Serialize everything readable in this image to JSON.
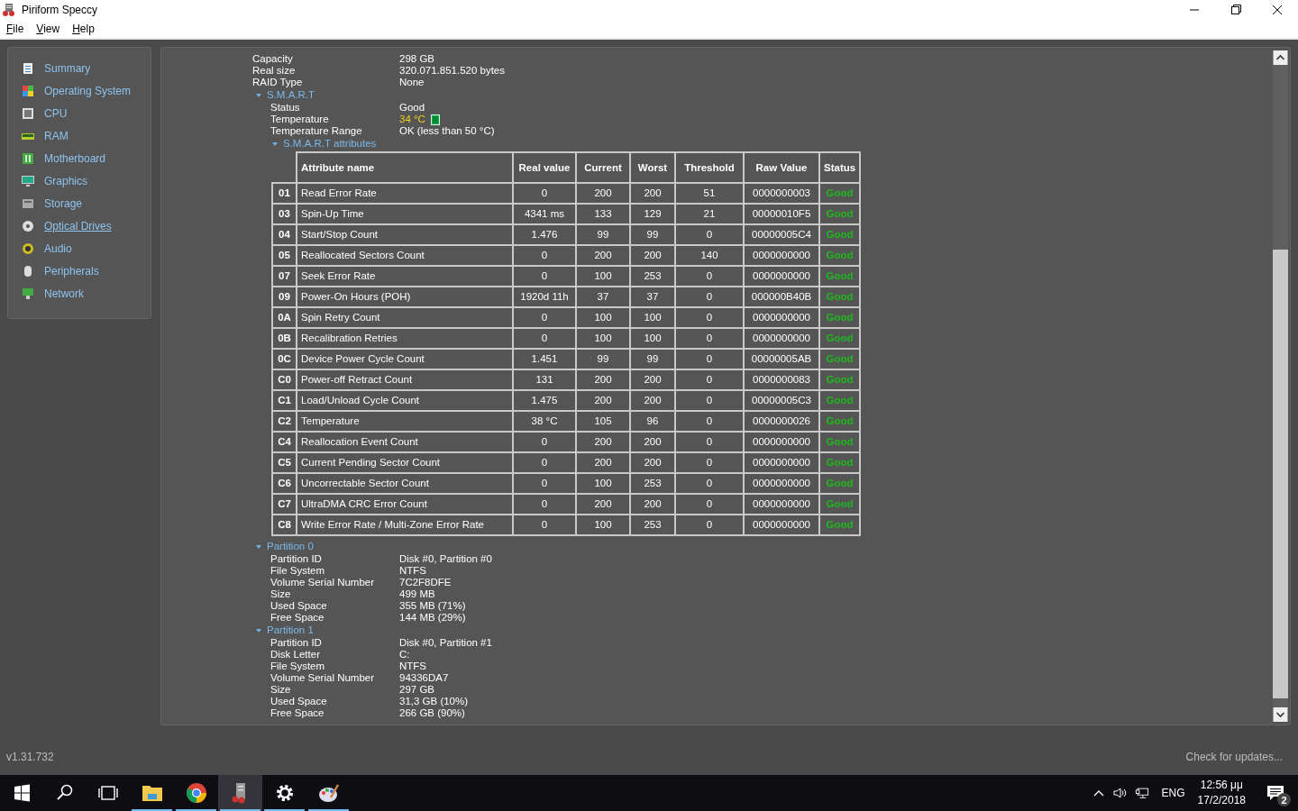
{
  "window": {
    "title": "Piriform Speccy"
  },
  "menu": [
    {
      "label": "File"
    },
    {
      "label": "View"
    },
    {
      "label": "Help"
    }
  ],
  "sidebar": {
    "items": [
      {
        "label": "Summary",
        "hovered": false
      },
      {
        "label": "Operating System",
        "hovered": false
      },
      {
        "label": "CPU",
        "hovered": false
      },
      {
        "label": "RAM",
        "hovered": false
      },
      {
        "label": "Motherboard",
        "hovered": false
      },
      {
        "label": "Graphics",
        "hovered": false
      },
      {
        "label": "Storage",
        "hovered": false
      },
      {
        "label": "Optical Drives",
        "hovered": true
      },
      {
        "label": "Audio",
        "hovered": false
      },
      {
        "label": "Peripherals",
        "hovered": false
      },
      {
        "label": "Network",
        "hovered": false
      }
    ]
  },
  "details": {
    "rows": [
      {
        "label": "Capacity",
        "value": "298 GB"
      },
      {
        "label": "Real size",
        "value": "320.071.851.520 bytes"
      },
      {
        "label": "RAID Type",
        "value": "None"
      }
    ],
    "smart": {
      "label": "S.M.A.R.T",
      "expanded": true,
      "rows": [
        {
          "kind": "text",
          "label": "Status",
          "value": "Good"
        },
        {
          "kind": "temperature",
          "label": "Temperature",
          "value": "34 °C"
        },
        {
          "kind": "text",
          "label": "Temperature Range",
          "value": "OK (less than 50 °C)"
        }
      ],
      "attributes": {
        "label": "S.M.A.R.T attributes",
        "expanded": true,
        "columns": [
          "Attribute name",
          "Real value",
          "Current",
          "Worst",
          "Threshold",
          "Raw Value",
          "Status"
        ],
        "rows": [
          {
            "id": "01",
            "name": "Read Error Rate",
            "real": "0",
            "current": "200",
            "worst": "200",
            "threshold": "51",
            "raw": "0000000003",
            "status": "Good"
          },
          {
            "id": "03",
            "name": "Spin-Up Time",
            "real": "4341 ms",
            "current": "133",
            "worst": "129",
            "threshold": "21",
            "raw": "00000010F5",
            "status": "Good"
          },
          {
            "id": "04",
            "name": "Start/Stop Count",
            "real": "1.476",
            "current": "99",
            "worst": "99",
            "threshold": "0",
            "raw": "00000005C4",
            "status": "Good"
          },
          {
            "id": "05",
            "name": "Reallocated Sectors Count",
            "real": "0",
            "current": "200",
            "worst": "200",
            "threshold": "140",
            "raw": "0000000000",
            "status": "Good"
          },
          {
            "id": "07",
            "name": "Seek Error Rate",
            "real": "0",
            "current": "100",
            "worst": "253",
            "threshold": "0",
            "raw": "0000000000",
            "status": "Good"
          },
          {
            "id": "09",
            "name": "Power-On Hours (POH)",
            "real": "1920d 11h",
            "current": "37",
            "worst": "37",
            "threshold": "0",
            "raw": "000000B40B",
            "status": "Good"
          },
          {
            "id": "0A",
            "name": "Spin Retry Count",
            "real": "0",
            "current": "100",
            "worst": "100",
            "threshold": "0",
            "raw": "0000000000",
            "status": "Good"
          },
          {
            "id": "0B",
            "name": "Recalibration Retries",
            "real": "0",
            "current": "100",
            "worst": "100",
            "threshold": "0",
            "raw": "0000000000",
            "status": "Good"
          },
          {
            "id": "0C",
            "name": "Device Power Cycle Count",
            "real": "1.451",
            "current": "99",
            "worst": "99",
            "threshold": "0",
            "raw": "00000005AB",
            "status": "Good"
          },
          {
            "id": "C0",
            "name": "Power-off Retract Count",
            "real": "131",
            "current": "200",
            "worst": "200",
            "threshold": "0",
            "raw": "0000000083",
            "status": "Good"
          },
          {
            "id": "C1",
            "name": "Load/Unload Cycle Count",
            "real": "1.475",
            "current": "200",
            "worst": "200",
            "threshold": "0",
            "raw": "00000005C3",
            "status": "Good"
          },
          {
            "id": "C2",
            "name": "Temperature",
            "real": "38 °C",
            "current": "105",
            "worst": "96",
            "threshold": "0",
            "raw": "0000000026",
            "status": "Good"
          },
          {
            "id": "C4",
            "name": "Reallocation Event Count",
            "real": "0",
            "current": "200",
            "worst": "200",
            "threshold": "0",
            "raw": "0000000000",
            "status": "Good"
          },
          {
            "id": "C5",
            "name": "Current Pending Sector Count",
            "real": "0",
            "current": "200",
            "worst": "200",
            "threshold": "0",
            "raw": "0000000000",
            "status": "Good"
          },
          {
            "id": "C6",
            "name": "Uncorrectable Sector Count",
            "real": "0",
            "current": "100",
            "worst": "253",
            "threshold": "0",
            "raw": "0000000000",
            "status": "Good"
          },
          {
            "id": "C7",
            "name": "UltraDMA CRC Error Count",
            "real": "0",
            "current": "200",
            "worst": "200",
            "threshold": "0",
            "raw": "0000000000",
            "status": "Good"
          },
          {
            "id": "C8",
            "name": "Write Error Rate / Multi-Zone Error Rate",
            "real": "0",
            "current": "100",
            "worst": "253",
            "threshold": "0",
            "raw": "0000000000",
            "status": "Good"
          }
        ]
      }
    },
    "partitions": [
      {
        "label": "Partition 0",
        "expanded": true,
        "rows": [
          {
            "label": "Partition ID",
            "value": "Disk #0, Partition #0"
          },
          {
            "label": "File System",
            "value": "NTFS"
          },
          {
            "label": "Volume Serial Number",
            "value": "7C2F8DFE"
          },
          {
            "label": "Size",
            "value": "499 MB"
          },
          {
            "label": "Used Space",
            "value": "355 MB (71%)"
          },
          {
            "label": "Free Space",
            "value": "144 MB (29%)"
          }
        ]
      },
      {
        "label": "Partition 1",
        "expanded": true,
        "rows": [
          {
            "label": "Partition ID",
            "value": "Disk #0, Partition #1"
          },
          {
            "label": "Disk Letter",
            "value": "C:"
          },
          {
            "label": "File System",
            "value": "NTFS"
          },
          {
            "label": "Volume Serial Number",
            "value": "94336DA7"
          },
          {
            "label": "Size",
            "value": "297 GB"
          },
          {
            "label": "Used Space",
            "value": "31,3 GB (10%)"
          },
          {
            "label": "Free Space",
            "value": "266 GB (90%)"
          }
        ]
      }
    ]
  },
  "footer": {
    "version": "v1.31.732",
    "update_link": "Check for updates..."
  },
  "taskbar": {
    "apps": [
      {
        "running": true,
        "active": false
      },
      {
        "running": true,
        "active": false
      },
      {
        "running": true,
        "active": true
      },
      {
        "running": true,
        "active": false
      },
      {
        "running": true,
        "active": false
      }
    ],
    "language": "ENG",
    "time": "12:56 μμ",
    "date": "17/2/2018",
    "notifications": "2"
  }
}
